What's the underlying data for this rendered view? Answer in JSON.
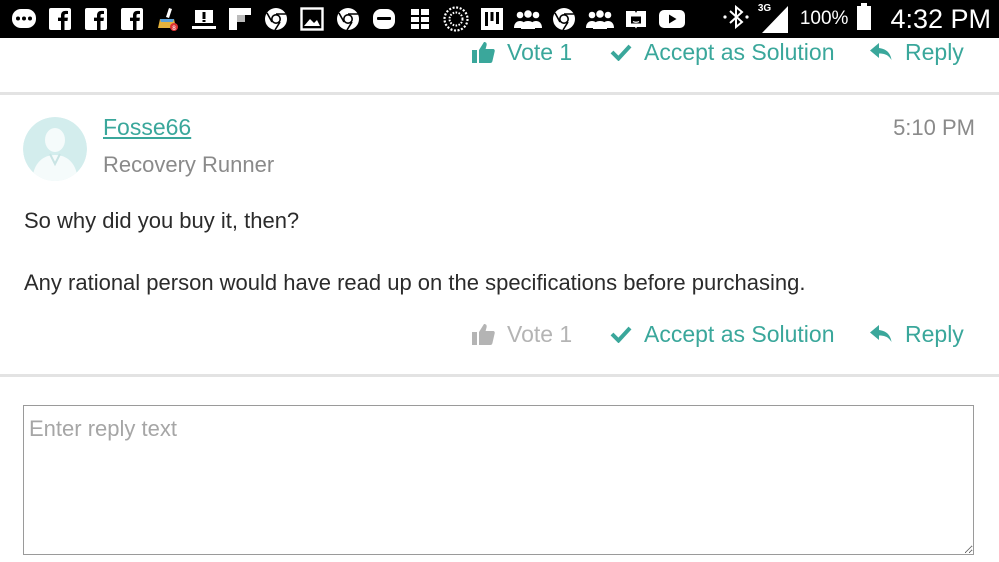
{
  "status_bar": {
    "notification_icons": [
      "messenger-icon",
      "facebook-icon",
      "facebook-icon",
      "facebook-icon",
      "cleaner-icon",
      "warning-icon",
      "flipboard-icon",
      "chrome-icon",
      "gallery-icon",
      "chrome-icon",
      "gallery-app-icon",
      "brick-icon",
      "burst-icon",
      "chart-icon",
      "people-icon",
      "chrome-icon",
      "people-icon",
      "amazon-kindle-icon",
      "youtube-icon"
    ],
    "network_type": "3G",
    "battery_percent": "100%",
    "time": "4:32 PM"
  },
  "colors": {
    "accent": "#3aa79b",
    "disabled": "#b4b4b4",
    "meta_text": "#8a8a8a",
    "body_text": "#2b2b2b",
    "divider": "#e3e3e3"
  },
  "previous_post_actions": {
    "vote_label": "Vote 1",
    "accept_label": "Accept as Solution",
    "reply_label": "Reply"
  },
  "post": {
    "author": "Fosse66",
    "rank": "Recovery Runner",
    "time": "5:10 PM",
    "paragraphs": [
      "So why did you buy it, then?",
      "Any rational person would have read up on the specifications before purchasing."
    ],
    "actions": {
      "vote_label": "Vote 1",
      "accept_label": "Accept as Solution",
      "reply_label": "Reply"
    }
  },
  "reply_box": {
    "placeholder": "Enter reply text",
    "value": ""
  }
}
